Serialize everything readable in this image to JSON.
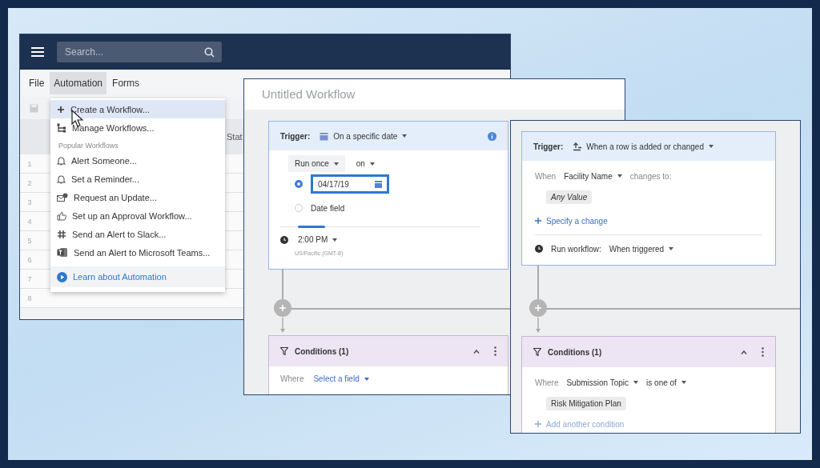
{
  "search": {
    "placeholder": "Search..."
  },
  "menu_bar": [
    {
      "label": "File",
      "selected": false
    },
    {
      "label": "Automation",
      "selected": true
    },
    {
      "label": "Forms",
      "selected": false
    }
  ],
  "grid": {
    "column_header": "Stat",
    "row_numbers": [
      "1",
      "2",
      "3",
      "4",
      "5",
      "6",
      "7",
      "8"
    ]
  },
  "dropdown": [
    {
      "kind": "action",
      "label": "Create a Workflow...",
      "selected": true
    },
    {
      "kind": "action",
      "label": "Manage Workflows...",
      "selected": false
    },
    {
      "kind": "heading",
      "label": "Popular Workflows"
    },
    {
      "kind": "action",
      "label": "Alert Someone...",
      "selected": false
    },
    {
      "kind": "action",
      "label": "Set a Reminder...",
      "selected": false
    },
    {
      "kind": "action",
      "label": "Request an Update...",
      "selected": false
    },
    {
      "kind": "action",
      "label": "Set up an Approval Workflow...",
      "selected": false
    },
    {
      "kind": "action",
      "label": "Send an Alert to Slack...",
      "selected": false
    },
    {
      "kind": "action",
      "label": "Send an Alert to Microsoft Teams...",
      "selected": false
    },
    {
      "kind": "link",
      "label": "Learn about Automation",
      "selected": false
    }
  ],
  "workflow_date": {
    "title": "Untitled Workflow",
    "trigger_label": "Trigger:",
    "trigger_value": "On a specific date",
    "frequency": "Run once",
    "preposition": "on",
    "options": [
      {
        "kind": "date",
        "value": "04/17/19",
        "selected": true
      },
      {
        "kind": "field",
        "label": "Date field",
        "selected": false
      }
    ],
    "time": "2:00 PM",
    "timezone": "US/Pacific (GMT-8)",
    "conditions": {
      "title": "Conditions (1)",
      "where": "Where",
      "field": "Select a field"
    }
  },
  "workflow_row": {
    "trigger_label": "Trigger:",
    "trigger_value": "When a row is added or changed",
    "when": "When",
    "field": "Facility Name",
    "changes": "changes to:",
    "value_chip": "Any Value",
    "specify_link": "Specify a change",
    "run_label": "Run workflow:",
    "run_value": "When triggered",
    "conditions": {
      "title": "Conditions (1)",
      "where": "Where",
      "field": "Submission Topic",
      "operator": "is one of",
      "chip": "Risk Mitigation Plan",
      "add_link": "Add another condition"
    }
  }
}
